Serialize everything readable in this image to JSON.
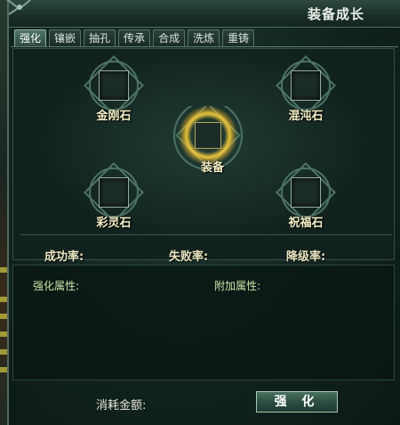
{
  "window": {
    "title": "装备成长"
  },
  "tabs": [
    {
      "label": "强化",
      "active": true
    },
    {
      "label": "镶嵌",
      "active": false
    },
    {
      "label": "抽孔",
      "active": false
    },
    {
      "label": "传承",
      "active": false
    },
    {
      "label": "合成",
      "active": false
    },
    {
      "label": "洗炼",
      "active": false
    },
    {
      "label": "重铸",
      "active": false
    }
  ],
  "slots": {
    "top_left": "金刚石",
    "top_right": "混沌石",
    "center": "装备",
    "bottom_left": "彩灵石",
    "bottom_right": "祝福石"
  },
  "rates": {
    "success": "成功率:",
    "fail": "失败率:",
    "downgrade": "降级率:"
  },
  "attributes": {
    "strengthen": "强化属性:",
    "extra": "附加属性:"
  },
  "footer": {
    "cost_label": "消耗金额:",
    "button_label": "强  化"
  }
}
